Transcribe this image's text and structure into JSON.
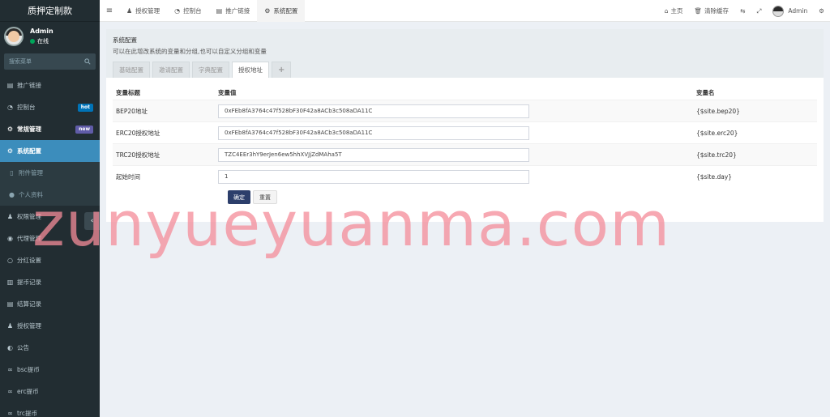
{
  "sidebar": {
    "brand": "质押定制款",
    "user": {
      "name": "Admin",
      "status": "在线"
    },
    "search_placeholder": "搜索菜单",
    "items": [
      {
        "label": "推广链接",
        "icon": "file-icon"
      },
      {
        "label": "控制台",
        "icon": "dashboard-icon",
        "badge": "hot"
      },
      {
        "label": "常规管理",
        "icon": "cogs-icon",
        "badge": "new"
      },
      {
        "label": "系统配置",
        "icon": "gear-icon"
      },
      {
        "label": "附件管理",
        "icon": "file-icon"
      },
      {
        "label": "个人资料",
        "icon": "user-icon"
      },
      {
        "label": "权限管理",
        "icon": "group-icon"
      },
      {
        "label": "代理管理",
        "icon": "user-circle-icon"
      },
      {
        "label": "分红设置",
        "icon": "circle-icon"
      },
      {
        "label": "提币记录",
        "icon": "list-icon"
      },
      {
        "label": "结算记录",
        "icon": "list-icon"
      },
      {
        "label": "授权管理",
        "icon": "group-icon"
      },
      {
        "label": "公告",
        "icon": "half-circle-icon"
      },
      {
        "label": "bsc提币",
        "icon": "link-icon"
      },
      {
        "label": "erc提币",
        "icon": "link-icon"
      },
      {
        "label": "trc提币",
        "icon": "link-icon"
      }
    ],
    "colors": {
      "bg": "#222d32",
      "active": "#3c8dbc",
      "hot": "#0073b7",
      "new": "#605ca8"
    }
  },
  "topbar": {
    "tabs": [
      {
        "label": "授权管理",
        "icon": "group-icon"
      },
      {
        "label": "控制台",
        "icon": "dashboard-icon"
      },
      {
        "label": "推广链接",
        "icon": "file-icon"
      },
      {
        "label": "系统配置",
        "icon": "gear-icon"
      }
    ],
    "right": {
      "home": "主页",
      "clear_cache": "清除缓存",
      "admin": "Admin"
    }
  },
  "panel": {
    "title": "系统配置",
    "description": "可以在此增改系统的变量和分组,也可以自定义分组和变量",
    "tabs": [
      "基础配置",
      "邀请配置",
      "字典配置",
      "授权地址"
    ],
    "add_tab": "+"
  },
  "table": {
    "headers": [
      "变量标题",
      "变量值",
      "变量名"
    ],
    "rows": [
      {
        "title": "BEP20地址",
        "value": "0xFEb8fA3764c47f528bF30F42a8ACb3c508aDA11C",
        "name": "{$site.bep20}"
      },
      {
        "title": "ERC20授权地址",
        "value": "0xFEb8fA3764c47f528bF30F42a8ACb3c508aDA11C",
        "name": "{$site.erc20}"
      },
      {
        "title": "TRC20授权地址",
        "value": "TZC4EEr3hY9erJen6ew5hhXVJjZdMAha5T",
        "name": "{$site.trc20}"
      },
      {
        "title": "起始时间",
        "value": "1",
        "name": "{$site.day}"
      }
    ]
  },
  "buttons": {
    "confirm": "确定",
    "reset": "重置"
  },
  "watermark": "zunyueyuanma.com"
}
